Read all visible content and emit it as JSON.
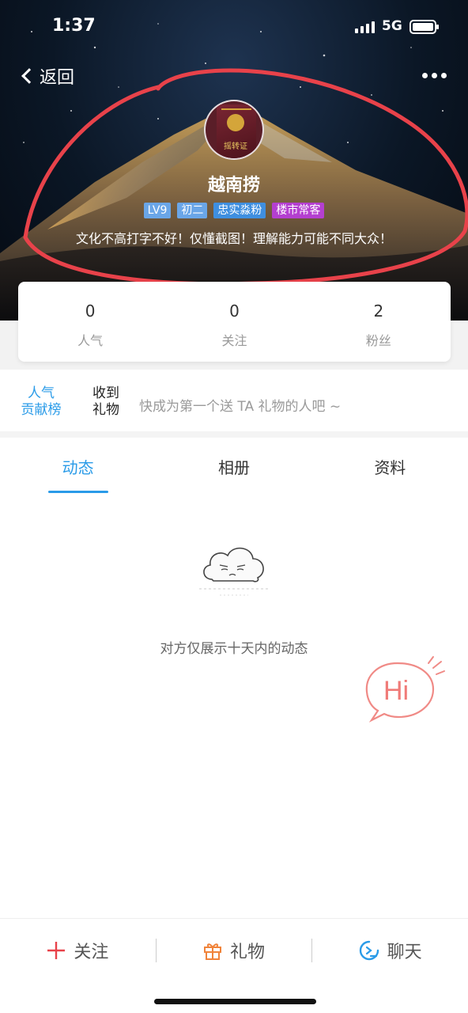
{
  "status_bar": {
    "time": "1:37",
    "network": "5G"
  },
  "nav": {
    "back_label": "返回"
  },
  "profile": {
    "avatar_label": "摇转证",
    "username": "越南捞",
    "tags": [
      {
        "label": "LV9",
        "color": "#6aa6e8"
      },
      {
        "label": "初二",
        "color": "#6aa6e8"
      },
      {
        "label": "忠实淼粉",
        "color": "#3f8fe0"
      },
      {
        "label": "楼市常客",
        "color": "#b43fd0"
      }
    ],
    "signature": "文化不高打字不好！仅懂截图！理解能力可能不同大众！"
  },
  "stats": [
    {
      "value": "0",
      "label": "人气"
    },
    {
      "value": "0",
      "label": "关注"
    },
    {
      "value": "2",
      "label": "粉丝"
    }
  ],
  "gifts": {
    "rank_line1": "人气",
    "rank_line2": "贡献榜",
    "received_line1": "收到",
    "received_line2": "礼物",
    "hint": "快成为第一个送 TA 礼物的人吧 ~"
  },
  "tabs": [
    {
      "label": "动态",
      "active": true
    },
    {
      "label": "相册",
      "active": false
    },
    {
      "label": "资料",
      "active": false
    }
  ],
  "empty_state": {
    "message": "对方仅展示十天内的动态"
  },
  "hi_bubble": {
    "text": "Hi"
  },
  "bottom_actions": {
    "follow_label": "关注",
    "gift_label": "礼物",
    "chat_label": "聊天"
  },
  "colors": {
    "accent": "#2a9be8",
    "annotation": "#e8424a",
    "follow_icon": "#e8424a",
    "gift_icon": "#f0833a",
    "chat_icon": "#2a9be8"
  },
  "icons": [
    "back-chevron-icon",
    "more-icon",
    "signal-icon",
    "battery-icon",
    "plus-icon",
    "gift-icon",
    "chat-icon",
    "cloud-icon",
    "hi-icon"
  ]
}
